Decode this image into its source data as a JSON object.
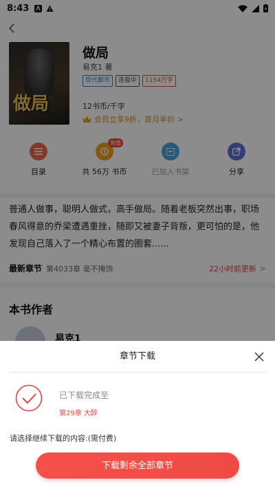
{
  "status_bar": {
    "time": "8:43"
  },
  "book": {
    "title": "做局",
    "author": "易克1 著",
    "cover_text": "做局",
    "tags": [
      "现代都市",
      "连载中",
      "1154万字"
    ],
    "price": "12书币/千字",
    "vip": "会员立享9折，首月半价",
    "vip_arrow": ">"
  },
  "actions": [
    {
      "label": "目录",
      "icon": "list-icon",
      "color": "#e8684a"
    },
    {
      "label": "共 56万 书币",
      "icon": "coin-icon",
      "color": "#f0a020",
      "badge": "充值"
    },
    {
      "label": "已加入书架",
      "icon": "bookshelf-icon",
      "color": "#4aa3df"
    },
    {
      "label": "分享",
      "icon": "share-icon",
      "color": "#5b6fd6"
    }
  ],
  "intro": "普通人做事，聪明人做式，高手做局。随着老板突然出事，职场春风得意的乔梁遭遇重挫，随即又被妻子背叛，更可怕的是，他发现自己落入了一个精心布置的圈套......",
  "latest": {
    "label": "最新章节",
    "chapter": "第4033章 毫不掩饰",
    "updated": "22小时前更新",
    "arrow": ">"
  },
  "author_section": {
    "heading": "本书作者",
    "name": "易克1"
  },
  "sheet": {
    "title": "章节下载",
    "done_label": "已下载完成至",
    "done_chapter": "第29章 大醉",
    "prompt": "请选择继续下载的内容:(需付费)",
    "button": "下载剩余全部章节"
  }
}
